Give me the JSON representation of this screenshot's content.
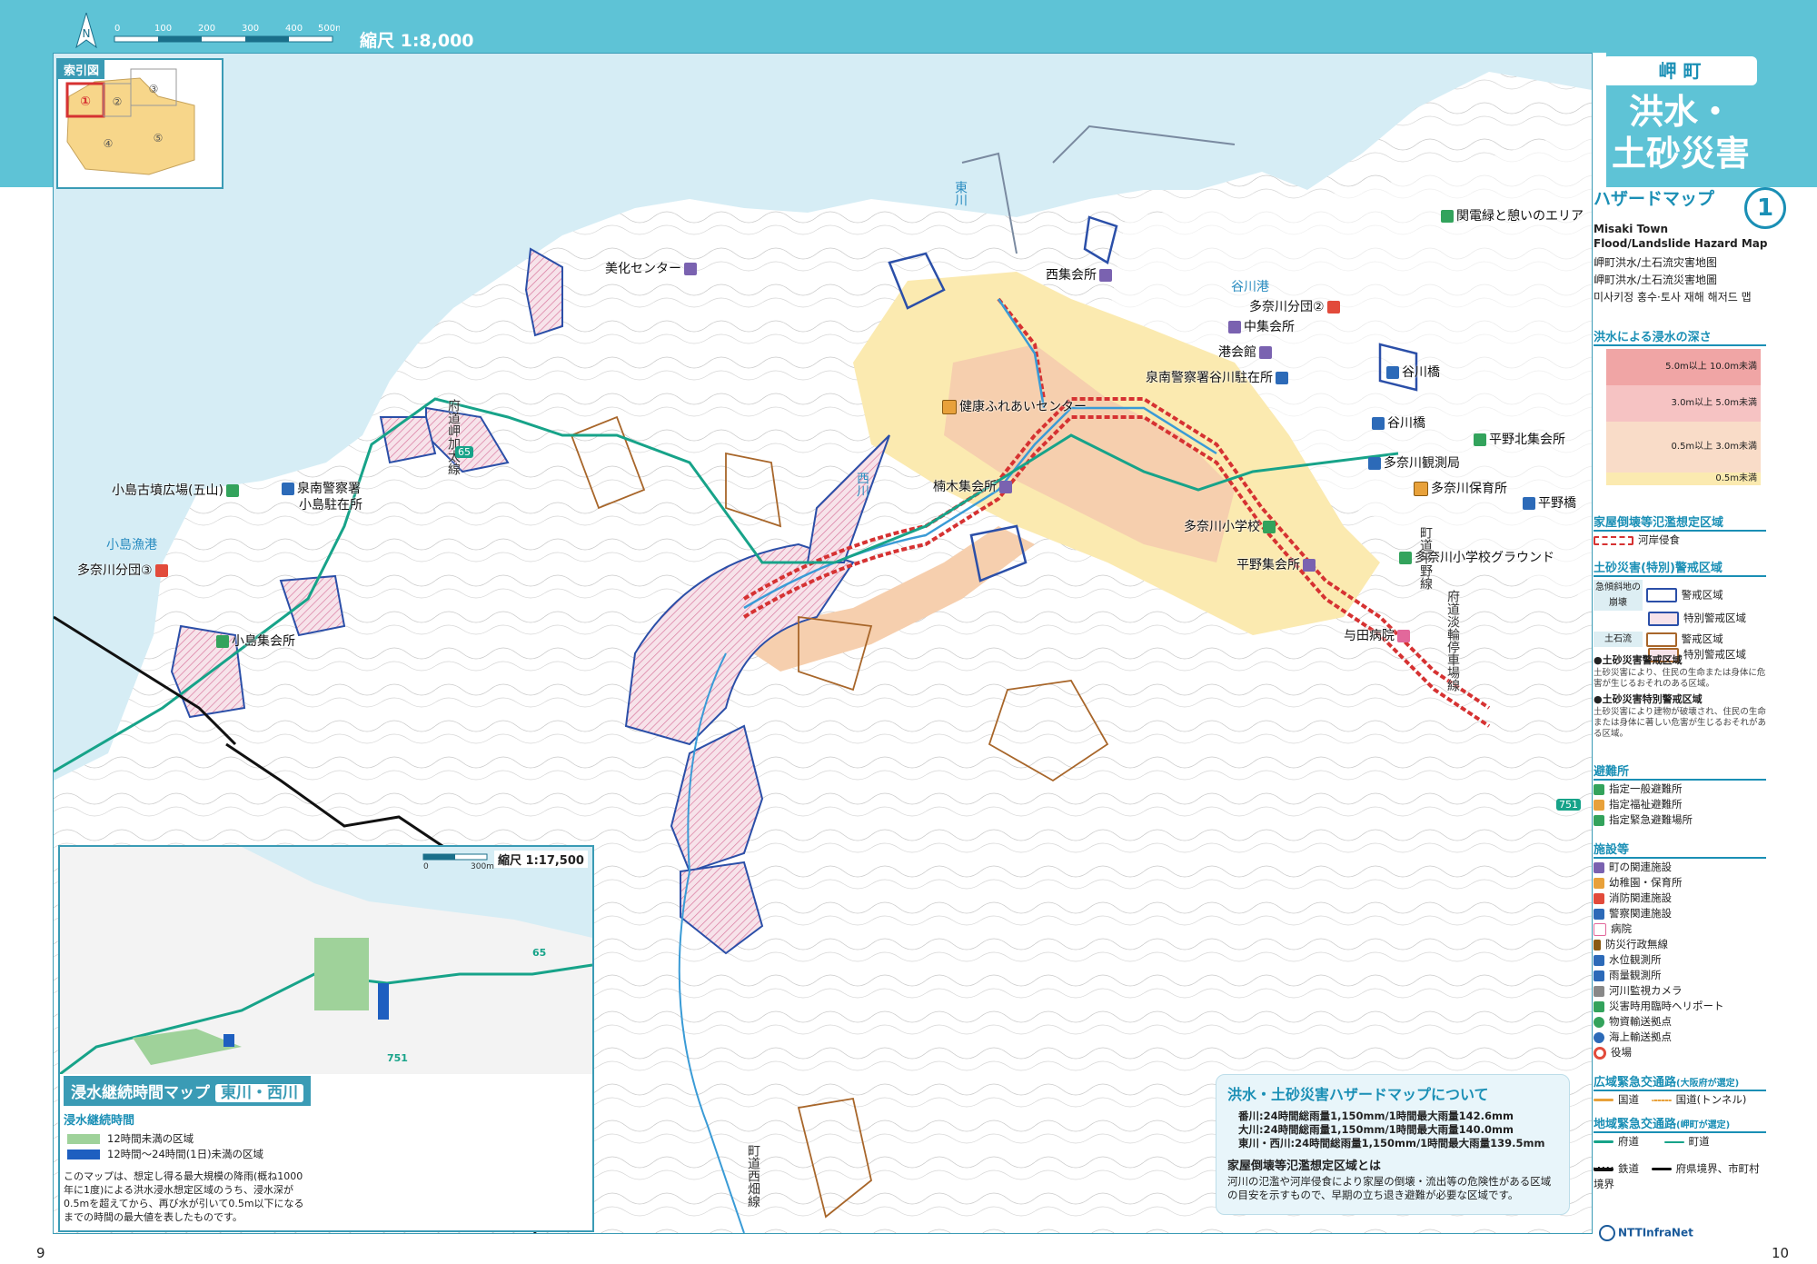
{
  "header": {
    "north_label": "N",
    "scale_ticks": [
      "0",
      "100",
      "200",
      "300",
      "400",
      "500m"
    ],
    "scale_label": "縮尺 1:8,000"
  },
  "index_map": {
    "title": "索引図",
    "areas": [
      "①",
      "②",
      "③",
      "④",
      "⑤"
    ]
  },
  "map_labels": {
    "bika": "美化センター",
    "nishi": "西集会所",
    "kanden": "関電緑と憩いのエリア",
    "tanagawa_port": "谷川港",
    "fire2": "多奈川分団②",
    "naka": "中集会所",
    "minato": "港会館",
    "police_tanagawa": "泉南警察署谷川駐在所",
    "tanigawa_bridge1": "谷川橋",
    "tanigawa_bridge2": "谷川橋",
    "hirano_north": "平野北集会所",
    "obs": "多奈川観測局",
    "nursery": "多奈川保育所",
    "hirano_bridge": "平野橋",
    "school": "多奈川小学校",
    "school_ground": "多奈川小学校グラウンド",
    "hirano": "平野集会所",
    "yoda": "与田病院",
    "kenko": "健康ふれあいセンター",
    "kusunoki": "楠木集会所",
    "kojima_tumulus": "小島古墳広場(五山)",
    "police_kojima_1": "泉南警察署",
    "police_kojima_2": "小島駐在所",
    "kojima_port": "小島漁港",
    "fire3": "多奈川分団③",
    "kojima_hall": "小島集会所",
    "river_east": "東川",
    "river_west": "西川",
    "road_kaigan": "府道岬加太線",
    "road_tanagawa": "町道西畑線",
    "road_heiya": "町道平野線",
    "road_fudo": "府道淡輪停車場線",
    "route65": "65",
    "route751": "751"
  },
  "inset": {
    "scale_ticks": [
      "0",
      "300m"
    ],
    "scale_label": "縮尺 1:17,500",
    "route65": "65",
    "route751": "751",
    "title": "浸水継続時間マップ",
    "title_sub": "東川・西川",
    "legend_title": "浸水継続時間",
    "legend_items": [
      "12時間未満の区域",
      "12時間〜24時間(1日)未満の区域"
    ],
    "note": "このマップは、想定し得る最大規模の降雨(概ね1000年に1度)による洪水浸水想定区域のうち、浸水深が0.5mを超えてから、再び水が引いて0.5m以下になるまでの時間の最大値を表したものです。"
  },
  "about": {
    "title": "洪水・土砂災害ハザードマップについて",
    "rain": [
      "番川:24時間総雨量1,150mm/1時間最大雨量142.6mm",
      "大川:24時間総雨量1,150mm/1時間最大雨量140.0mm",
      "東川・西川:24時間総雨量1,150mm/1時間最大雨量139.5mm"
    ],
    "subtitle": "家屋倒壊等氾濫想定区域とは",
    "text": "河川の氾濫や河岸侵食により家屋の倒壊・流出等の危険性がある区域の目安を示すもので、早期の立ち退き避難が必要な区域です。"
  },
  "sidebar": {
    "town": "岬 町",
    "title_line1": "洪水・",
    "title_line2": "土砂災害",
    "hazard": "ハザードマップ",
    "hazard_num": "1",
    "english1": "Misaki Town",
    "english2": "Flood/Landslide Hazard Map",
    "trans1": "岬町洪水/土石流灾害地图",
    "trans2": "岬町洪水/土石流災害地圖",
    "trans3": "미사키정 홍수·토사 재해 해저드 맵",
    "depth_title": "洪水による浸水の深さ",
    "depth_levels": [
      "5.0m以上 10.0m未満",
      "3.0m以上 5.0m未満",
      "0.5m以上 3.0m未満",
      "0.5m未満"
    ],
    "collapse_title": "家屋倒壊等氾濫想定区域",
    "collapse_item": "河岸侵食",
    "landslide_title": "土砂災害(特別)警戒区域",
    "steep": "急傾斜地の崩壊",
    "debris": "土石流",
    "warn": "警戒区域",
    "special": "特別警戒区域",
    "warn2": "警戒区域",
    "special2": "特別警戒区域",
    "def1_title": "●土砂災害警戒区域",
    "def1_text": "土砂災害により、住民の生命または身体に危害が生じるおそれのある区域。",
    "def2_title": "●土砂災害特別警戒区域",
    "def2_text": "土砂災害により建物が破壊され、住民の生命または身体に著しい危害が生じるおそれがある区域。",
    "shelter_title": "避難所",
    "shelters": [
      "指定一般避難所",
      "指定福祉避難所",
      "指定緊急避難場所"
    ],
    "facility_title": "施設等",
    "facilities": [
      "町の関連施設",
      "幼稚園・保育所",
      "消防関連施設",
      "警察関連施設",
      "病院",
      "防災行政無線",
      "水位観測所",
      "雨量観測所",
      "河川監視カメラ",
      "災害時用臨時ヘリポート",
      "物資輸送拠点",
      "海上輸送拠点",
      "役場"
    ],
    "wide_title": "広域緊急交通路",
    "wide_note": "(大阪府が選定)",
    "wide_items": [
      "国道",
      "国道(トンネル)"
    ],
    "local_title": "地域緊急交通路",
    "local_note": "(岬町が選定)",
    "local_items": [
      "府道",
      "町道"
    ],
    "rail": "鉄道",
    "border": "府県境界、市町村境界",
    "logo": "NTTInfraNet"
  },
  "pages": {
    "left": "9",
    "right": "10"
  },
  "colors": {
    "accent": "#5ec3d6",
    "sea": "#d6edf5",
    "flood_light": "#fbeab0",
    "flood_mid": "#f6cfae",
    "hazard_blue": "#2b4fa8",
    "hazard_red": "#d63232",
    "road_green": "#17a389"
  }
}
